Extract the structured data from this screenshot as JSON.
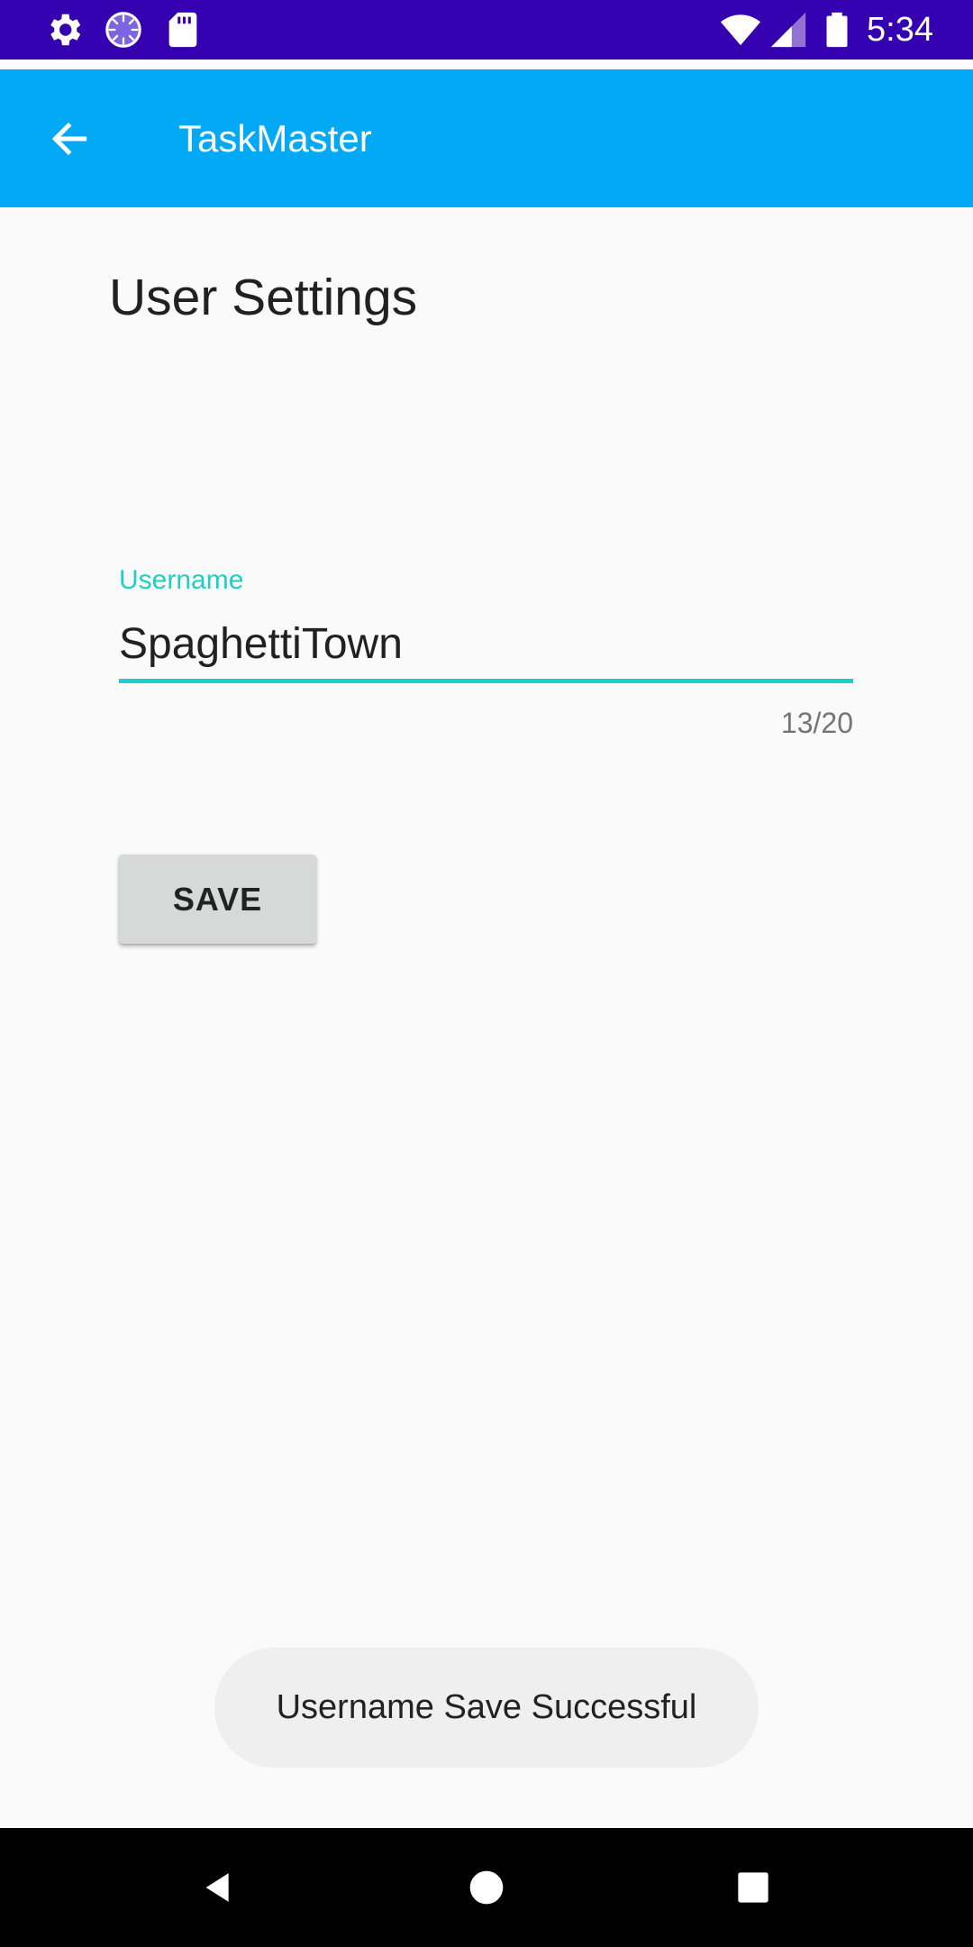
{
  "status_bar": {
    "time": "5:34",
    "left_icons": [
      "gear-icon",
      "sync-icon",
      "sd-card-icon"
    ],
    "right_icons": [
      "wifi-icon",
      "signal-icon",
      "battery-icon"
    ]
  },
  "app_bar": {
    "title": "TaskMaster",
    "back_icon": "arrow-left-icon"
  },
  "page": {
    "title": "User Settings"
  },
  "username_field": {
    "label": "Username",
    "value": "SpaghettiTown",
    "counter": "13/20",
    "accent_color": "#1dcfc5"
  },
  "save_button": {
    "label": "SAVE"
  },
  "toast": {
    "message": "Username Save Successful"
  },
  "nav_bar": {
    "buttons": [
      "back-triangle-icon",
      "home-circle-icon",
      "recents-square-icon"
    ]
  },
  "colors": {
    "status_bar": "#3500b0",
    "app_bar": "#03a9f4",
    "background": "#fafafa"
  }
}
